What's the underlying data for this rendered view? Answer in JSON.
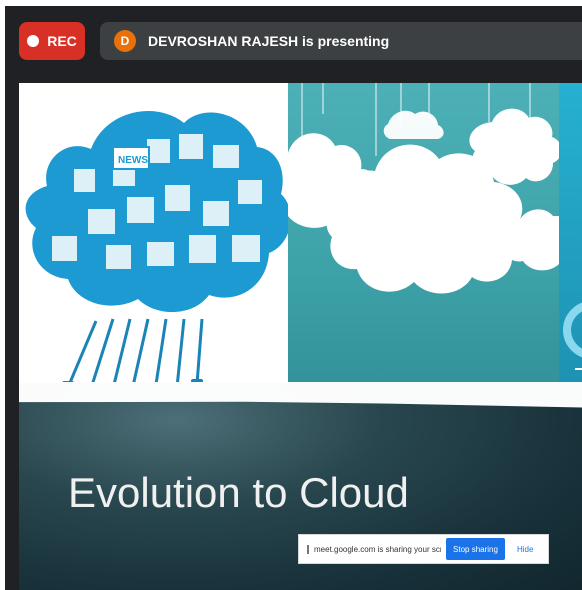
{
  "meeting": {
    "recording_label": "REC",
    "presenter_initial": "D",
    "presenter_text": "DEVROSHAN RAJESH is presenting"
  },
  "slide": {
    "title": "Evolution to Cloud",
    "small_label": "NEWS"
  },
  "sharing_bar": {
    "message": "meet.google.com is sharing your screen.",
    "stop_label": "Stop sharing",
    "hide_label": "Hide"
  },
  "colors": {
    "rec_red": "#d93025",
    "teal": "#3ea2a9",
    "accent_blue": "#1a73e8",
    "avatar_orange": "#e8710a"
  },
  "icons": [
    "record-dot-icon",
    "cloud-icon-collage",
    "drag-handle-icon"
  ]
}
